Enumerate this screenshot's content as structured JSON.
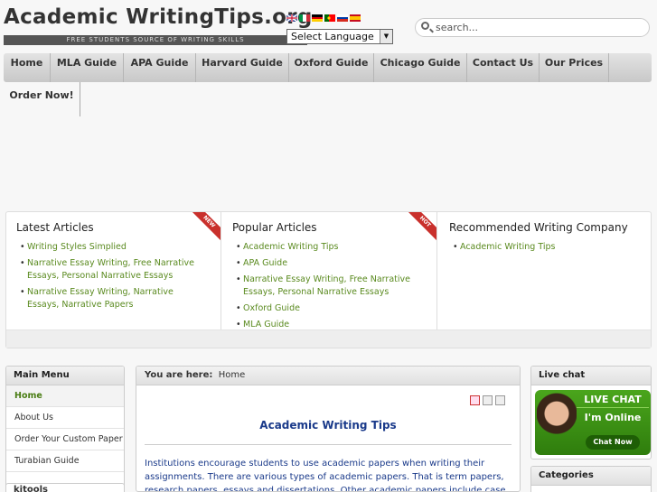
{
  "header": {
    "site_title": "Academic WritingTips.org",
    "tagline": "FREE STUDENTS SOURCE OF WRITING SKILLS",
    "language_select": "Select Language",
    "search_placeholder": "search...",
    "flags": [
      "uk-flag-icon",
      "italy-flag-icon",
      "germany-flag-icon",
      "portugal-flag-icon",
      "russia-flag-icon",
      "spain-flag-icon"
    ]
  },
  "nav": {
    "items": [
      "Home",
      "MLA Guide",
      "APA Guide",
      "Harvard Guide",
      "Oxford Guide",
      "Chicago Guide",
      "Contact Us",
      "Our Prices"
    ],
    "second_row": "Order Now!"
  },
  "features": {
    "latest": {
      "title": "Latest Articles",
      "badge": "NEW",
      "items": [
        "Writing Styles Simplied",
        "Narrative Essay Writing, Free Narrative Essays, Personal Narrative Essays",
        "Narrative Essay Writing, Narrative Essays, Narrative Papers"
      ]
    },
    "popular": {
      "title": "Popular Articles",
      "badge": "HOT",
      "items": [
        "Academic Writing Tips",
        "APA Guide",
        "Narrative Essay Writing, Free Narrative Essays, Personal Narrative Essays",
        "Oxford Guide",
        "MLA Guide"
      ]
    },
    "recommended": {
      "title": "Recommended Writing Company",
      "items": [
        "Academic Writing Tips"
      ]
    }
  },
  "main_menu": {
    "title": "Main Menu",
    "items": [
      "Home",
      "About Us",
      "Order Your Custom Paper",
      "Turabian Guide"
    ],
    "next_box_title": "kitools"
  },
  "content": {
    "breadcrumb_label": "You are here:",
    "breadcrumb_value": "Home",
    "heading": "Academic Writing Tips",
    "body": "Institutions encourage students to use academic papers when writing their assignments. There are various types of academic papers. That is term papers, research papers, essays and dissertations. Other academic papers include case"
  },
  "sidebar_right": {
    "live_chat_title": "Live chat",
    "chat_banner": "LIVE CHAT",
    "chat_status": "I'm Online",
    "chat_button": "Chat Now",
    "categories_title": "Categories"
  },
  "colors": {
    "link_green": "#5a8a1f",
    "heading_blue": "#1a3a8a",
    "ribbon_red": "#c9302c"
  }
}
